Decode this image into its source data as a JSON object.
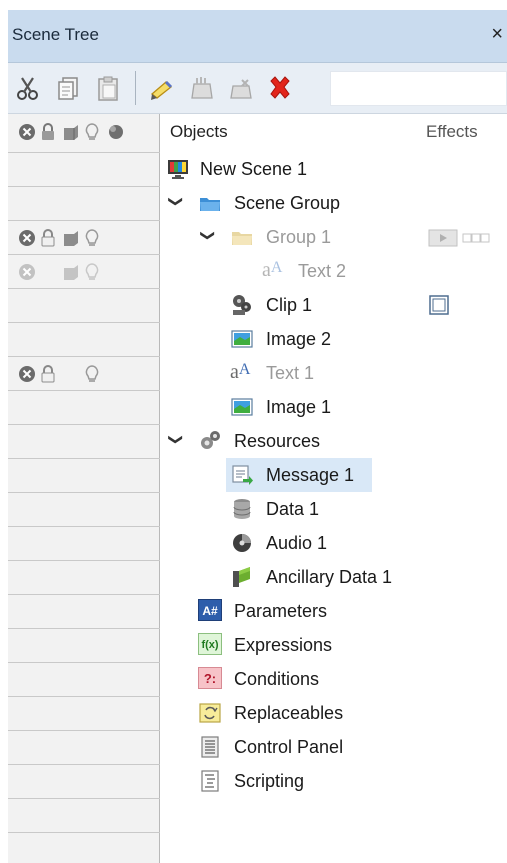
{
  "window": {
    "title": "Scene Tree",
    "close_glyph": "×"
  },
  "toolbar": {
    "buttons": [
      {
        "name": "cut-icon"
      },
      {
        "name": "copy-icon"
      },
      {
        "name": "paste-icon"
      },
      {
        "name": "rename-icon"
      },
      {
        "name": "add-icon"
      },
      {
        "name": "remove-icon"
      },
      {
        "name": "delete-icon"
      }
    ],
    "search_value": ""
  },
  "columns": {
    "objects": "Objects",
    "effects": "Effects"
  },
  "state_header_icons": [
    "disable-icon",
    "lock-icon",
    "visibility-icon",
    "light-icon",
    "shadow-icon"
  ],
  "tree": [
    {
      "label": "New Scene 1",
      "icon": "scene-icon",
      "expanded": null
    },
    {
      "label": "Scene Group",
      "icon": "folder-icon",
      "expanded": true
    },
    {
      "label": "Group 1",
      "icon": "folder-icon",
      "expanded": true,
      "dimmed": true
    },
    {
      "label": "Text 2",
      "icon": "text-icon",
      "dimmed": true
    },
    {
      "label": "Clip 1",
      "icon": "clip-icon"
    },
    {
      "label": "Image 2",
      "icon": "image-icon"
    },
    {
      "label": "Text 1",
      "icon": "text-icon",
      "dimmed": true
    },
    {
      "label": "Image 1",
      "icon": "image-icon"
    },
    {
      "label": "Resources",
      "icon": "resources-icon",
      "expanded": true
    },
    {
      "label": "Message 1",
      "icon": "message-icon",
      "selected": true
    },
    {
      "label": "Data 1",
      "icon": "database-icon"
    },
    {
      "label": "Audio 1",
      "icon": "audio-icon"
    },
    {
      "label": "Ancillary Data 1",
      "icon": "ancillary-icon"
    },
    {
      "label": "Parameters",
      "icon": "parameters-icon",
      "badge": "A#"
    },
    {
      "label": "Expressions",
      "icon": "expressions-icon",
      "badge": "f(x)"
    },
    {
      "label": "Conditions",
      "icon": "conditions-icon",
      "badge": "?:"
    },
    {
      "label": "Replaceables",
      "icon": "replaceables-icon"
    },
    {
      "label": "Control Panel",
      "icon": "control-panel-icon"
    },
    {
      "label": "Scripting",
      "icon": "scripting-icon"
    }
  ]
}
